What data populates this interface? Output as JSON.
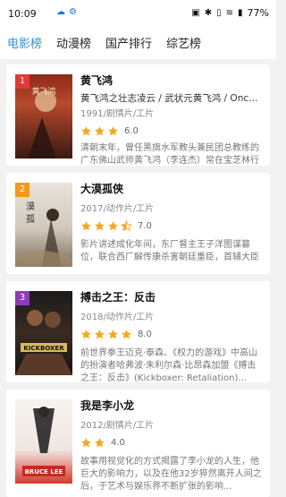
{
  "status_bar": {
    "time": "10:09",
    "battery": "77%"
  },
  "tabs": [
    {
      "label": "电影榜",
      "active": true
    },
    {
      "label": "动漫榜",
      "active": false
    },
    {
      "label": "国产排行",
      "active": false
    },
    {
      "label": "综艺榜",
      "active": false
    }
  ],
  "movies": [
    {
      "rank": "1",
      "title": "黄飞鸿",
      "alias": "黄飞鸿之壮志凌云 / 武状元黄飞鸿 / Once Upon a Time in China",
      "meta": "1991/剧情片/工片",
      "rating": "6.0",
      "stars": 3,
      "desc": "清朝末年，曾任黑旗水军教头兼民团总教练的广东佛山武师黄飞鸿（李连杰）常在宝芝林行医济世..."
    },
    {
      "rank": "2",
      "title": "大漠孤侠",
      "alias": "",
      "meta": "2017/动作片/工片",
      "rating": "7.0",
      "stars": 3.5,
      "desc": "影片讲述成化年间，东厂督主王子洋图谋篡位，联合西厂解传康杀害朝廷重臣，首辅大臣卢全安被害前嘱托义女若兰去大漠寻找..."
    },
    {
      "rank": "3",
      "title": "搏击之王：反击",
      "alias": "",
      "meta": "2018/动作片/工片",
      "rating": "8.0",
      "stars": 4,
      "desc": "前世界拳王迈克·泰森、《权力的游戏》中高山的扮演者哈弗波·朱利尔森·比昂森加盟《搏击之王：反击》(Kickboxer: Retaliation)..."
    },
    {
      "rank": "",
      "title": "我是李小龙",
      "alias": "",
      "meta": "2012/剧情片/工片",
      "rating": "4.0",
      "stars": 2,
      "desc": "故事用视觉化的方式揭露了李小龙的人生，他巨大的影响力，以及在他32岁猝然离开人间之后，于艺术与娱乐界不断扩张的影响..."
    }
  ],
  "colors": {
    "accent": "#2f8fe0",
    "star": "#f5a623"
  }
}
